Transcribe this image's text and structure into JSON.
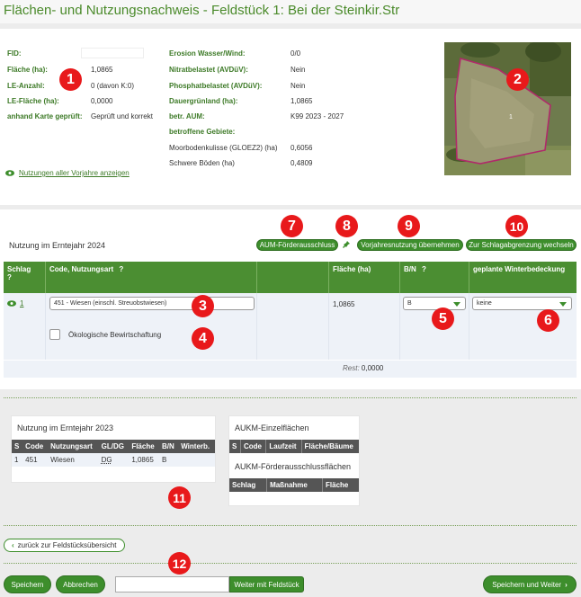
{
  "page": {
    "title": "Flächen- und Nutzungsnachweis - Feldstück 1: Bei der Steinkir.Str"
  },
  "info_left": [
    {
      "label": "FID:",
      "value": ""
    },
    {
      "label": "Fläche (ha):",
      "value": "1,0865"
    },
    {
      "label": "LE-Anzahl:",
      "value": "0 (davon K:0)"
    },
    {
      "label": "LE-Fläche (ha):",
      "value": "0,0000"
    },
    {
      "label": "anhand Karte geprüft:",
      "value": "Geprüft und korrekt"
    }
  ],
  "info_right": [
    {
      "label": "Erosion Wasser/Wind:",
      "value": "0/0"
    },
    {
      "label": "Nitratbelastet (AVDüV):",
      "value": "Nein"
    },
    {
      "label": "Phosphatbelastet (AVDüV):",
      "value": "Nein"
    },
    {
      "label": "Dauergrünland (ha):",
      "value": "1,0865"
    },
    {
      "label": "betr. AUM:",
      "value": "K99 2023 - 2027"
    },
    {
      "label": "betroffene Gebiete:",
      "value": ""
    }
  ],
  "gebiete": [
    {
      "label": "Moorbodenkulisse (GLOEZ2) (ha)",
      "value": "0,6056"
    },
    {
      "label": "Schwere Böden (ha)",
      "value": "0,4809"
    }
  ],
  "vorjahre_link": "Nutzungen aller Vorjahre anzeigen",
  "map": {
    "field_number": "1"
  },
  "markers": [
    "1",
    "2",
    "3",
    "4",
    "5",
    "6",
    "7",
    "8",
    "9",
    "10",
    "11",
    "12"
  ],
  "nutzung": {
    "title": "Nutzung im Erntejahr 2024",
    "btn_aum": "AUM-Förderausschluss",
    "btn_vorjahr": "Vorjahresnutzung übernehmen",
    "btn_schlag": "Zur Schlagabgrenzung wechseln",
    "headers": {
      "schlag": "Schlag",
      "code": "Code, Nutzungsart",
      "flaeche": "Fläche (ha)",
      "bn": "B/N",
      "winter": "geplante Winterbedeckung",
      "help": "?"
    },
    "row": {
      "schlag": "1",
      "code_value": "451 - Wiesen (einschl. Streuobstwiesen)",
      "flaeche": "1,0865",
      "bn": "B",
      "winter": "keine",
      "oeko_label": "Ökologische Bewirtschaftung"
    },
    "rest_label": "Rest:",
    "rest_value": "0,0000"
  },
  "prev": {
    "title": "Nutzung im Erntejahr 2023",
    "headers": [
      "S",
      "Code",
      "Nutzungsart",
      "GL/DG",
      "Fläche",
      "B/N",
      "Winterb."
    ],
    "row": [
      "1",
      "451",
      "Wiesen",
      "DG",
      "1,0865",
      "B",
      ""
    ]
  },
  "aukm": {
    "title1": "AUKM-Einzelflächen",
    "headers1": [
      "S",
      "Code",
      "Laufzeit",
      "Fläche/Bäume"
    ],
    "title2": "AUKM-Förderausschlussflächen",
    "headers2": [
      "Schlag",
      "Maßnahme",
      "Fläche"
    ]
  },
  "footer": {
    "back": "zurück zur Feldstücksübersicht",
    "save": "Speichern",
    "cancel": "Abbrechen",
    "weiter_mit": "Weiter mit Feldstück",
    "save_next": "Speichern und Weiter"
  },
  "colors": {
    "accent": "#3d8e2c",
    "marker": "#e8191b",
    "header": "#4b8e32"
  }
}
